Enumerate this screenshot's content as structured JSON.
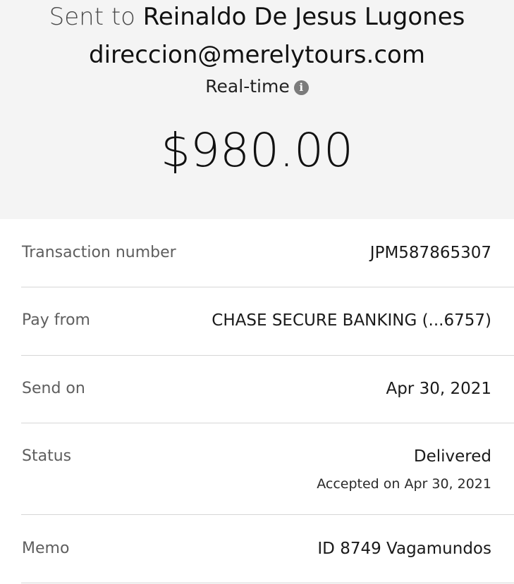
{
  "header": {
    "sent_prefix": "Sent to",
    "recipient_name": "Reinaldo De Jesus Lugones",
    "recipient_email": "direccion@merelytours.com",
    "delivery_speed": "Real-time",
    "info_icon": "info-icon",
    "amount": "$980.00"
  },
  "details": {
    "transaction_number": {
      "label": "Transaction number",
      "value": "JPM587865307"
    },
    "pay_from": {
      "label": "Pay from",
      "value": "CHASE SECURE BANKING (...6757)"
    },
    "send_on": {
      "label": "Send on",
      "value": "Apr 30, 2021"
    },
    "status": {
      "label": "Status",
      "value": "Delivered",
      "subvalue": "Accepted on Apr 30, 2021"
    },
    "memo": {
      "label": "Memo",
      "value": "ID 8749 Vagamundos"
    }
  },
  "colors": {
    "header_background": "#f4f4f4",
    "divider": "#d6d6d6",
    "label_text": "#5e5e5e"
  }
}
